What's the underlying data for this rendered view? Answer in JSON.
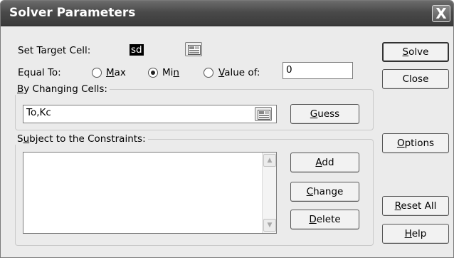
{
  "window": {
    "title": "Solver Parameters",
    "close_glyph": "X"
  },
  "target": {
    "label": "Set Target Cell:",
    "value": "sd"
  },
  "equal_to": {
    "label": "Equal To:",
    "options": [
      {
        "prefix": "",
        "accel": "M",
        "rest": "ax",
        "selected": false
      },
      {
        "prefix": "Mi",
        "accel": "n",
        "rest": "",
        "selected": true
      },
      {
        "prefix": "",
        "accel": "V",
        "rest": "alue of:",
        "selected": false
      }
    ],
    "value_of": "0"
  },
  "changing": {
    "label_accel": "B",
    "label_rest": "y Changing Cells:",
    "value": "To,Kc",
    "guess_accel": "G",
    "guess_rest": "uess"
  },
  "constraints": {
    "label_prefix": "S",
    "label_accel": "u",
    "label_rest": "bject to the Constraints:",
    "items": [],
    "add_accel": "A",
    "add_rest": "dd",
    "change_accel": "C",
    "change_rest": "hange",
    "delete_accel": "D",
    "delete_rest": "elete"
  },
  "side_buttons": {
    "solve_accel": "S",
    "solve_rest": "olve",
    "close_label": "Close",
    "options_accel": "O",
    "options_rest": "ptions",
    "reset_prefix": "",
    "reset_accel": "R",
    "reset_rest": "eset All",
    "help_accel": "H",
    "help_rest": "elp"
  },
  "icons": {
    "ref_collapse": "collapse-dialog-icon",
    "scroll_up": "scroll-up-icon",
    "scroll_down": "scroll-down-icon"
  }
}
